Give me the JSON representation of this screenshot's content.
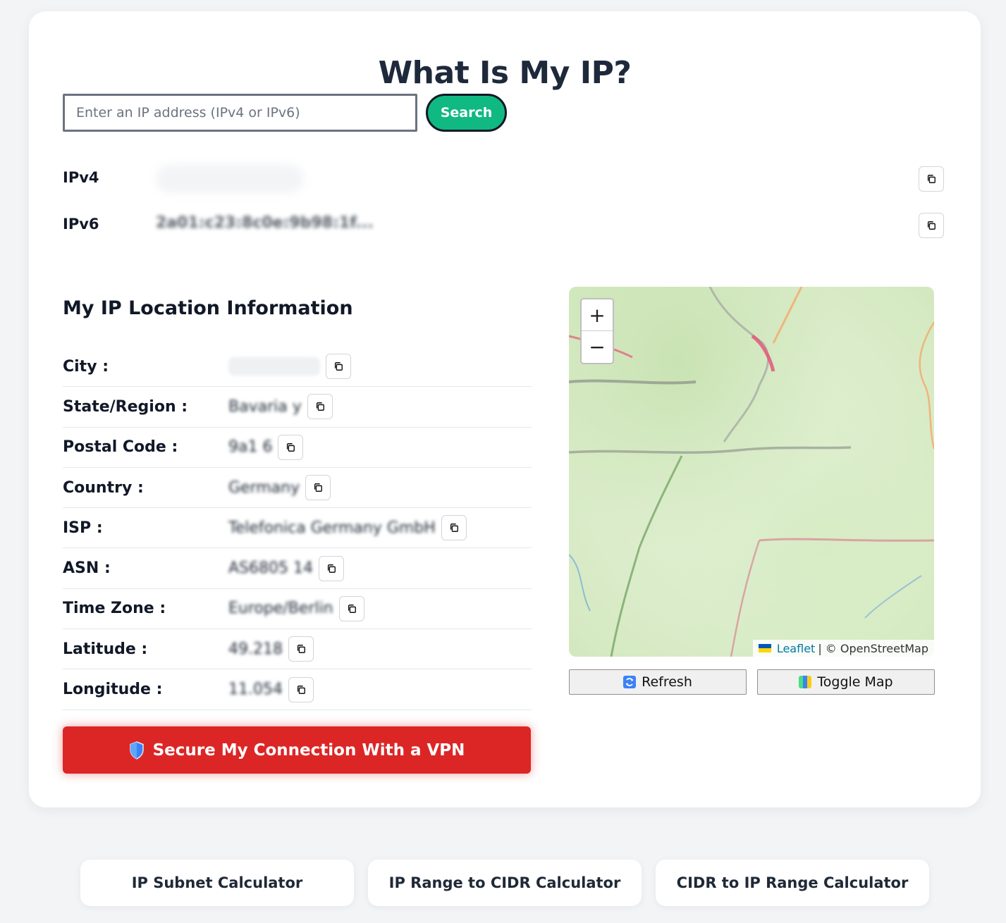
{
  "header": {
    "title": "What Is My IP?"
  },
  "search": {
    "placeholder": "Enter an IP address (IPv4 or IPv6)",
    "button_label": "Search"
  },
  "ip": {
    "ipv4_label": "IPv4",
    "ipv4_value": "",
    "ipv6_label": "IPv6",
    "ipv6_value": "2a01:c23:8c0e:9b98:1f..."
  },
  "location": {
    "title": "My IP Location Information",
    "rows": [
      {
        "label": "City :",
        "value": ""
      },
      {
        "label": "State/Region :",
        "value": "Bavaria y"
      },
      {
        "label": "Postal Code :",
        "value": "9a1 6"
      },
      {
        "label": "Country :",
        "value": "Germany"
      },
      {
        "label": "ISP :",
        "value": "Telefonica Germany GmbH"
      },
      {
        "label": "ASN :",
        "value": "AS6805 14"
      },
      {
        "label": "Time Zone :",
        "value": "Europe/Berlin"
      },
      {
        "label": "Latitude :",
        "value": "49.218"
      },
      {
        "label": "Longitude :",
        "value": "11.054"
      }
    ]
  },
  "vpn": {
    "label": "Secure My Connection With a VPN"
  },
  "map": {
    "zoom_in": "+",
    "zoom_out": "−",
    "attribution_link": "Leaflet",
    "attribution_text": "| © OpenStreetMap",
    "refresh_label": "Refresh",
    "toggle_label": "Toggle Map"
  },
  "tools": [
    {
      "label": "IP Subnet Calculator"
    },
    {
      "label": "IP Range to CIDR Calculator"
    },
    {
      "label": "CIDR to IP Range Calculator"
    }
  ],
  "colors": {
    "accent_green": "#10b981",
    "vpn_red": "#dc2626",
    "link_blue": "#0078a8"
  }
}
